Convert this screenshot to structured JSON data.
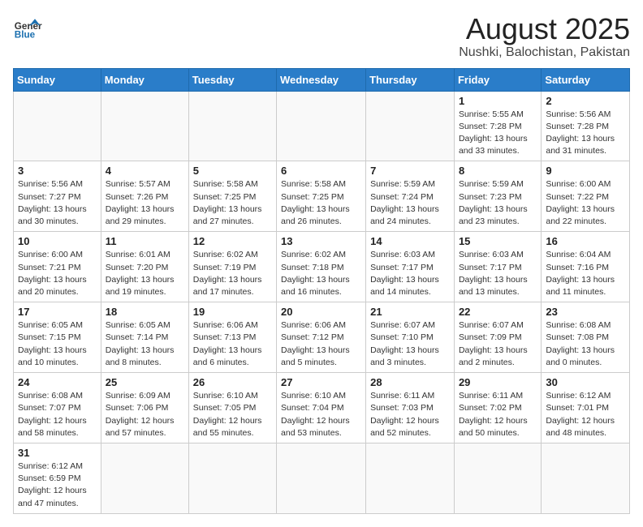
{
  "header": {
    "logo_general": "General",
    "logo_blue": "Blue",
    "title": "August 2025",
    "subtitle": "Nushki, Balochistan, Pakistan"
  },
  "weekdays": [
    "Sunday",
    "Monday",
    "Tuesday",
    "Wednesday",
    "Thursday",
    "Friday",
    "Saturday"
  ],
  "weeks": [
    [
      {
        "day": "",
        "info": ""
      },
      {
        "day": "",
        "info": ""
      },
      {
        "day": "",
        "info": ""
      },
      {
        "day": "",
        "info": ""
      },
      {
        "day": "",
        "info": ""
      },
      {
        "day": "1",
        "info": "Sunrise: 5:55 AM\nSunset: 7:28 PM\nDaylight: 13 hours and 33 minutes."
      },
      {
        "day": "2",
        "info": "Sunrise: 5:56 AM\nSunset: 7:28 PM\nDaylight: 13 hours and 31 minutes."
      }
    ],
    [
      {
        "day": "3",
        "info": "Sunrise: 5:56 AM\nSunset: 7:27 PM\nDaylight: 13 hours and 30 minutes."
      },
      {
        "day": "4",
        "info": "Sunrise: 5:57 AM\nSunset: 7:26 PM\nDaylight: 13 hours and 29 minutes."
      },
      {
        "day": "5",
        "info": "Sunrise: 5:58 AM\nSunset: 7:25 PM\nDaylight: 13 hours and 27 minutes."
      },
      {
        "day": "6",
        "info": "Sunrise: 5:58 AM\nSunset: 7:25 PM\nDaylight: 13 hours and 26 minutes."
      },
      {
        "day": "7",
        "info": "Sunrise: 5:59 AM\nSunset: 7:24 PM\nDaylight: 13 hours and 24 minutes."
      },
      {
        "day": "8",
        "info": "Sunrise: 5:59 AM\nSunset: 7:23 PM\nDaylight: 13 hours and 23 minutes."
      },
      {
        "day": "9",
        "info": "Sunrise: 6:00 AM\nSunset: 7:22 PM\nDaylight: 13 hours and 22 minutes."
      }
    ],
    [
      {
        "day": "10",
        "info": "Sunrise: 6:00 AM\nSunset: 7:21 PM\nDaylight: 13 hours and 20 minutes."
      },
      {
        "day": "11",
        "info": "Sunrise: 6:01 AM\nSunset: 7:20 PM\nDaylight: 13 hours and 19 minutes."
      },
      {
        "day": "12",
        "info": "Sunrise: 6:02 AM\nSunset: 7:19 PM\nDaylight: 13 hours and 17 minutes."
      },
      {
        "day": "13",
        "info": "Sunrise: 6:02 AM\nSunset: 7:18 PM\nDaylight: 13 hours and 16 minutes."
      },
      {
        "day": "14",
        "info": "Sunrise: 6:03 AM\nSunset: 7:17 PM\nDaylight: 13 hours and 14 minutes."
      },
      {
        "day": "15",
        "info": "Sunrise: 6:03 AM\nSunset: 7:17 PM\nDaylight: 13 hours and 13 minutes."
      },
      {
        "day": "16",
        "info": "Sunrise: 6:04 AM\nSunset: 7:16 PM\nDaylight: 13 hours and 11 minutes."
      }
    ],
    [
      {
        "day": "17",
        "info": "Sunrise: 6:05 AM\nSunset: 7:15 PM\nDaylight: 13 hours and 10 minutes."
      },
      {
        "day": "18",
        "info": "Sunrise: 6:05 AM\nSunset: 7:14 PM\nDaylight: 13 hours and 8 minutes."
      },
      {
        "day": "19",
        "info": "Sunrise: 6:06 AM\nSunset: 7:13 PM\nDaylight: 13 hours and 6 minutes."
      },
      {
        "day": "20",
        "info": "Sunrise: 6:06 AM\nSunset: 7:12 PM\nDaylight: 13 hours and 5 minutes."
      },
      {
        "day": "21",
        "info": "Sunrise: 6:07 AM\nSunset: 7:10 PM\nDaylight: 13 hours and 3 minutes."
      },
      {
        "day": "22",
        "info": "Sunrise: 6:07 AM\nSunset: 7:09 PM\nDaylight: 13 hours and 2 minutes."
      },
      {
        "day": "23",
        "info": "Sunrise: 6:08 AM\nSunset: 7:08 PM\nDaylight: 13 hours and 0 minutes."
      }
    ],
    [
      {
        "day": "24",
        "info": "Sunrise: 6:08 AM\nSunset: 7:07 PM\nDaylight: 12 hours and 58 minutes."
      },
      {
        "day": "25",
        "info": "Sunrise: 6:09 AM\nSunset: 7:06 PM\nDaylight: 12 hours and 57 minutes."
      },
      {
        "day": "26",
        "info": "Sunrise: 6:10 AM\nSunset: 7:05 PM\nDaylight: 12 hours and 55 minutes."
      },
      {
        "day": "27",
        "info": "Sunrise: 6:10 AM\nSunset: 7:04 PM\nDaylight: 12 hours and 53 minutes."
      },
      {
        "day": "28",
        "info": "Sunrise: 6:11 AM\nSunset: 7:03 PM\nDaylight: 12 hours and 52 minutes."
      },
      {
        "day": "29",
        "info": "Sunrise: 6:11 AM\nSunset: 7:02 PM\nDaylight: 12 hours and 50 minutes."
      },
      {
        "day": "30",
        "info": "Sunrise: 6:12 AM\nSunset: 7:01 PM\nDaylight: 12 hours and 48 minutes."
      }
    ],
    [
      {
        "day": "31",
        "info": "Sunrise: 6:12 AM\nSunset: 6:59 PM\nDaylight: 12 hours and 47 minutes."
      },
      {
        "day": "",
        "info": ""
      },
      {
        "day": "",
        "info": ""
      },
      {
        "day": "",
        "info": ""
      },
      {
        "day": "",
        "info": ""
      },
      {
        "day": "",
        "info": ""
      },
      {
        "day": "",
        "info": ""
      }
    ]
  ]
}
